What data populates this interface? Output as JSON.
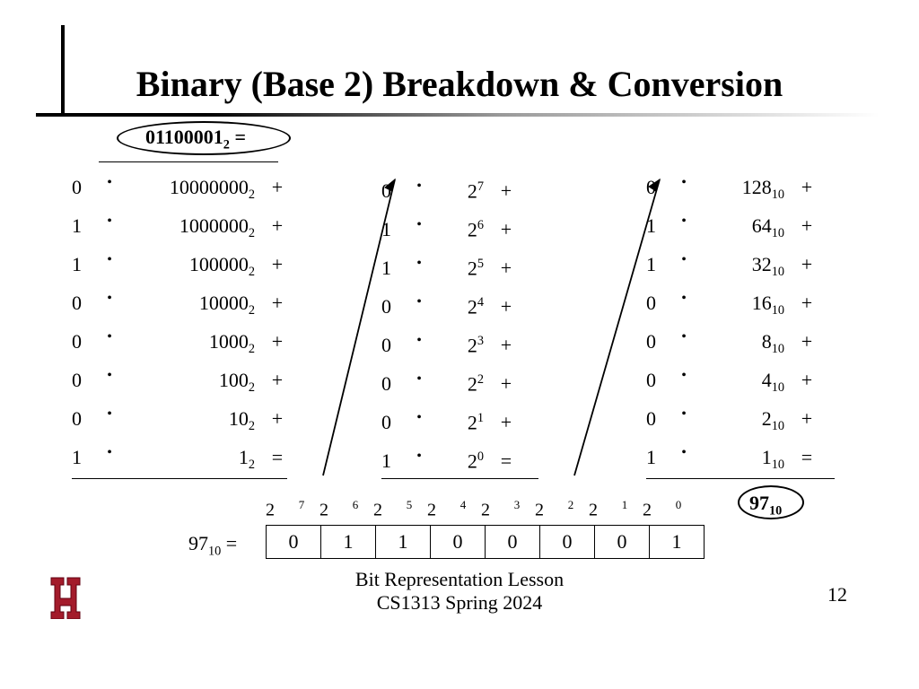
{
  "title": "Binary (Base 2) Breakdown & Conversion",
  "binary_header": {
    "value": "01100001",
    "base": "2",
    "eq": " ="
  },
  "col1": {
    "rows": [
      {
        "coef": "0",
        "val": "10000000",
        "base": "2",
        "op": "+"
      },
      {
        "coef": "1",
        "val": "1000000",
        "base": "2",
        "op": "+"
      },
      {
        "coef": "1",
        "val": "100000",
        "base": "2",
        "op": "+"
      },
      {
        "coef": "0",
        "val": "10000",
        "base": "2",
        "op": "+"
      },
      {
        "coef": "0",
        "val": "1000",
        "base": "2",
        "op": "+"
      },
      {
        "coef": "0",
        "val": "100",
        "base": "2",
        "op": "+"
      },
      {
        "coef": "0",
        "val": "10",
        "base": "2",
        "op": "+"
      },
      {
        "coef": "1",
        "val": "1",
        "base": "2",
        "op": "="
      }
    ]
  },
  "col2": {
    "rows": [
      {
        "coef": "0",
        "base": "2",
        "exp": "7",
        "op": "+"
      },
      {
        "coef": "1",
        "base": "2",
        "exp": "6",
        "op": "+"
      },
      {
        "coef": "1",
        "base": "2",
        "exp": "5",
        "op": "+"
      },
      {
        "coef": "0",
        "base": "2",
        "exp": "4",
        "op": "+"
      },
      {
        "coef": "0",
        "base": "2",
        "exp": "3",
        "op": "+"
      },
      {
        "coef": "0",
        "base": "2",
        "exp": "2",
        "op": "+"
      },
      {
        "coef": "0",
        "base": "2",
        "exp": "1",
        "op": "+"
      },
      {
        "coef": "1",
        "base": "2",
        "exp": "0",
        "op": "="
      }
    ]
  },
  "col3": {
    "rows": [
      {
        "coef": "0",
        "val": "128",
        "base": "10",
        "op": "+"
      },
      {
        "coef": "1",
        "val": "64",
        "base": "10",
        "op": "+"
      },
      {
        "coef": "1",
        "val": "32",
        "base": "10",
        "op": "+"
      },
      {
        "coef": "0",
        "val": "16",
        "base": "10",
        "op": "+"
      },
      {
        "coef": "0",
        "val": "8",
        "base": "10",
        "op": "+"
      },
      {
        "coef": "0",
        "val": "4",
        "base": "10",
        "op": "+"
      },
      {
        "coef": "0",
        "val": "2",
        "base": "10",
        "op": "+"
      },
      {
        "coef": "1",
        "val": "1",
        "base": "10",
        "op": "="
      }
    ]
  },
  "result": {
    "value": "97",
    "base": "10"
  },
  "bit_powers": [
    {
      "base": "2",
      "exp": "7"
    },
    {
      "base": "2",
      "exp": "6"
    },
    {
      "base": "2",
      "exp": "5"
    },
    {
      "base": "2",
      "exp": "4"
    },
    {
      "base": "2",
      "exp": "3"
    },
    {
      "base": "2",
      "exp": "2"
    },
    {
      "base": "2",
      "exp": "1"
    },
    {
      "base": "2",
      "exp": "0"
    }
  ],
  "bit_eq": {
    "value": "97",
    "base": "10",
    "eq": " ="
  },
  "bits": [
    "0",
    "1",
    "1",
    "0",
    "0",
    "0",
    "0",
    "1"
  ],
  "footer": {
    "line1": "Bit Representation Lesson",
    "line2": "CS1313 Spring 2024"
  },
  "page_number": "12"
}
